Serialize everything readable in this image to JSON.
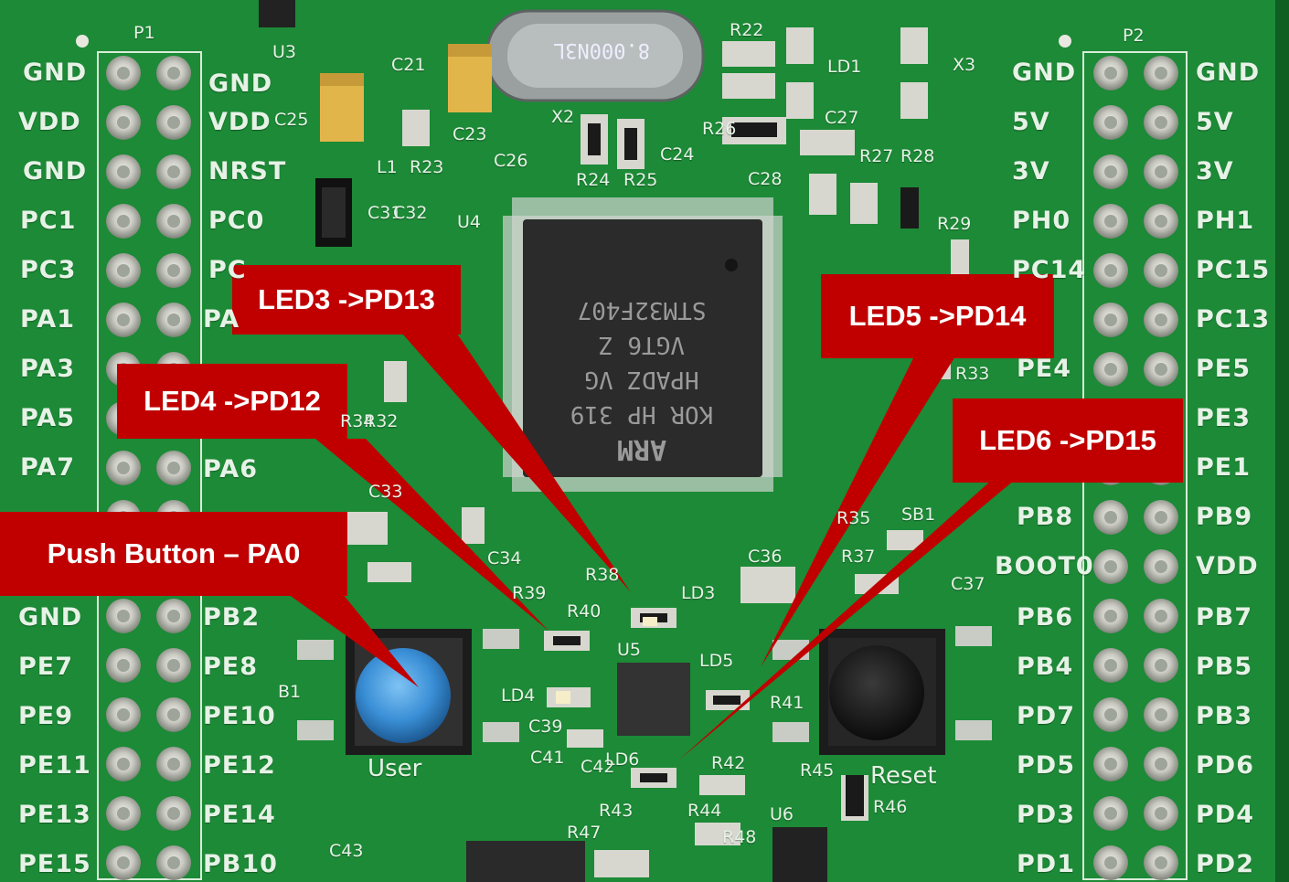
{
  "callouts": {
    "led3": "LED3 ->PD13",
    "led4": "LED4 ->PD12",
    "led5": "LED5 ->PD14",
    "led6": "LED6 ->PD15",
    "push_button": "Push Button – PA0"
  },
  "header_p1": {
    "name": "P1",
    "left_labels": [
      "GND",
      "VDD",
      "GND",
      "PC1",
      "PC3",
      "PA1",
      "PA3",
      "PA5",
      "PA7",
      "GND",
      "PE7",
      "PE9",
      "PE11",
      "PE13",
      "PE15"
    ],
    "right_labels": [
      "GND",
      "VDD",
      "NRST",
      "PC0",
      "PC",
      "PA",
      "PA6",
      "PB2",
      "PE8",
      "PE10",
      "PE12",
      "PE14",
      "PB10"
    ]
  },
  "header_p2": {
    "name": "P2",
    "left_labels": [
      "GND",
      "5V",
      "3V",
      "PH0",
      "PC14",
      "PE4",
      "PB8",
      "BOOT0",
      "PB6",
      "PB4",
      "PD7",
      "PD5",
      "PD3",
      "PD1"
    ],
    "right_labels": [
      "GND",
      "5V",
      "3V",
      "PH1",
      "PC15",
      "PC13",
      "PE5",
      "PE3",
      "PE1",
      "PB9",
      "VDD",
      "PB7",
      "PB5",
      "PB3",
      "PD6",
      "PD4",
      "PD2"
    ]
  },
  "chip": {
    "lines": [
      "STM32F407",
      "VGT6   Z",
      "HPADZ VG",
      "KOR HP 319"
    ],
    "brand": "ARM"
  },
  "crystal": "8.000N3L",
  "buttons": {
    "user": "User",
    "reset": "Reset"
  },
  "silkscreen": [
    "U3",
    "X2",
    "X3",
    "U4",
    "U5",
    "U6",
    "B1",
    "C33",
    "C36",
    "C37",
    "SB1",
    "R37",
    "R40",
    "LD3",
    "LD4",
    "LD5",
    "LD6",
    "R41",
    "R42",
    "R45",
    "R46",
    "R29",
    "R33",
    "R22",
    "R23",
    "R24",
    "R25",
    "R26",
    "R27",
    "R28",
    "C21",
    "C23",
    "C24",
    "C25",
    "C26",
    "C27",
    "C28",
    "C31",
    "C32",
    "C34",
    "C39",
    "C41",
    "C42",
    "C43",
    "R32",
    "R34",
    "R35",
    "R38",
    "R39",
    "R43",
    "R44",
    "R47",
    "R48",
    "L1",
    "LD1"
  ],
  "colors": {
    "board": "#1f8f3a",
    "callout": "#c00000",
    "button_blue": "#3a8fd6",
    "chip": "#2b2b2b"
  }
}
